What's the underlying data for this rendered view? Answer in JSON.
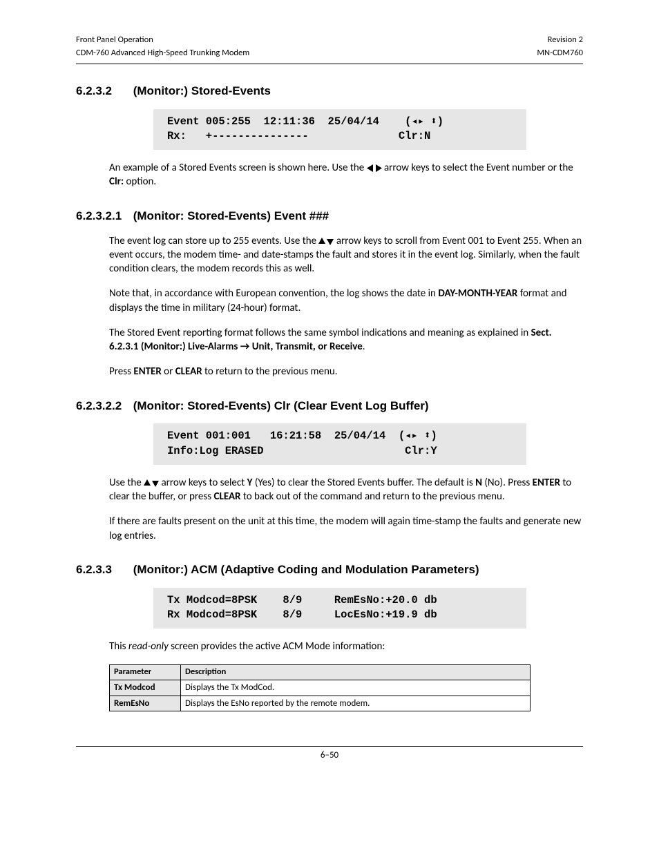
{
  "header": {
    "left1": "Front Panel Operation",
    "right1": "Revision 2",
    "left2": "CDM-760 Advanced High-Speed Trunking Modem",
    "right2": "MN-CDM760"
  },
  "s6232": {
    "num": "6.2.3.2",
    "title": "(Monitor:) Stored-Events",
    "lcd": "Event 005:255  12:11:36  25/04/14    (◂▸ ⬍)\nRx:   +---------------              Clr:N",
    "p1a": "An example of a Stored Events screen is shown here. Use the ",
    "p1b": " arrow keys to select the Event number or the ",
    "p1c": " option.",
    "clr": "Clr:"
  },
  "s62321": {
    "num": "6.2.3.2.1",
    "title": "(Monitor: Stored-Events) Event ###",
    "p1a": "The event log can store up to 255 events. Use the ",
    "p1b": " arrow keys to scroll from Event 001 to Event 255. When an event occurs, the modem time- and date-stamps the fault and stores it in the event log. Similarly, when the fault condition clears, the modem records this as well.",
    "p2a": "Note that, in accordance with European convention, the log shows the date in ",
    "p2b": "DAY-MONTH-YEAR",
    "p2c": " format and displays the time in military (24-hour) format.",
    "p3a": "The Stored Event reporting format follows the same symbol indications and meaning as explained in ",
    "p3b": "Sect. 6.2.3.1 (Monitor:) Live-Alarms → Unit, Transmit, or Receive",
    "p3c": ".",
    "p4a": "Press ",
    "p4b": "ENTER",
    "p4c": " or ",
    "p4d": "CLEAR",
    "p4e": " to return to the previous menu."
  },
  "s62322": {
    "num": "6.2.3.2.2",
    "title": "(Monitor: Stored-Events) Clr (Clear Event Log Buffer)",
    "lcd": "Event 001:001   16:21:58  25/04/14  (◂▸ ⬍)\nInfo:Log ERASED                      Clr:Y",
    "p1a": "Use the  ",
    "p1b": " arrow keys to select ",
    "p1c": "Y",
    "p1d": " (Yes) to clear the Stored Events buffer. The default is ",
    "p1e": "N",
    "p1f": " (No). Press ",
    "p1g": "ENTER",
    "p1h": " to clear the buffer, or press ",
    "p1i": "CLEAR",
    "p1j": " to back out of the command and return to the previous menu.",
    "p2": "If there are faults present on the unit at this time, the modem will again time-stamp the faults and generate new log entries."
  },
  "s6233": {
    "num": "6.2.3.3",
    "title": "(Monitor:) ACM (Adaptive Coding and Modulation Parameters)",
    "lcd": "Tx Modcod=8PSK    8/9     RemEsNo:+20.0 db\nRx Modcod=8PSK    8/9     LocEsNo:+19.9 db",
    "p1a": "This ",
    "p1b": "read-only",
    "p1c": " screen provides the active ACM Mode information:",
    "table": {
      "h1": "Parameter",
      "h2": "Description",
      "rows": [
        {
          "p": "Tx Modcod",
          "d": "Displays the Tx ModCod."
        },
        {
          "p": "RemEsNo",
          "d": "Displays the EsNo reported by the remote modem."
        }
      ]
    }
  },
  "footer": "6–50"
}
